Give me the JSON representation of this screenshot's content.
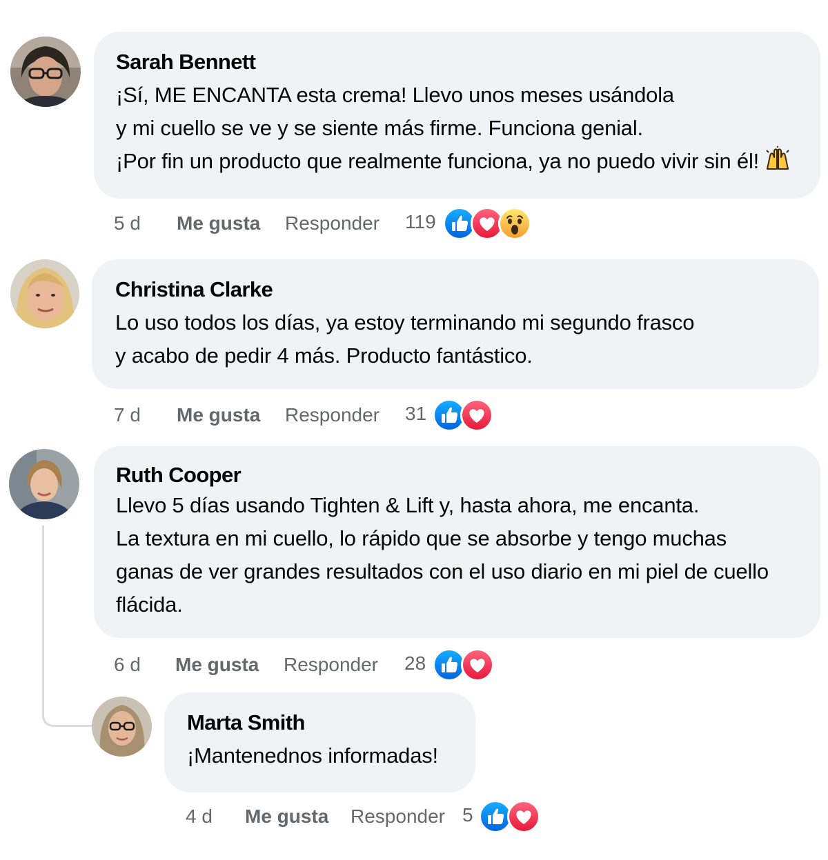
{
  "comments": [
    {
      "author": "Sarah Bennett",
      "lines": [
        "¡Sí, ME ENCANTA esta crema! Llevo unos meses usándola",
        "y mi cuello se ve y se siente más firme. Funciona genial.",
        "¡Por fin un producto que realmente funciona, ya no puedo vivir sin él!"
      ],
      "trailing_emoji": "🙌",
      "time": "5 d",
      "like_label": "Me gusta",
      "reply_label": "Responder",
      "reaction_count": "119",
      "reactions": [
        "like-icon",
        "love-icon",
        "wow-icon"
      ]
    },
    {
      "author": "Christina Clarke",
      "lines": [
        "Lo uso todos los días, ya estoy terminando mi segundo frasco",
        "y acabo de pedir 4 más. Producto fantástico."
      ],
      "time": "7 d",
      "like_label": "Me gusta",
      "reply_label": "Responder",
      "reaction_count": "31",
      "reactions": [
        "like-icon",
        "love-icon"
      ]
    },
    {
      "author": "Ruth Cooper",
      "lines": [
        "Llevo 5 días usando Tighten & Lift y, hasta ahora, me encanta.",
        "La textura en mi cuello, lo rápido que se absorbe y tengo muchas",
        "ganas de ver grandes resultados con el uso diario en mi piel de cuello",
        "flácida."
      ],
      "time": "6 d",
      "like_label": "Me gusta",
      "reply_label": "Responder",
      "reaction_count": "28",
      "reactions": [
        "like-icon",
        "love-icon"
      ]
    },
    {
      "author": "Marta Smith",
      "lines": [
        "¡Mantenednos informadas!"
      ],
      "time": "4 d",
      "like_label": "Me gusta",
      "reply_label": "Responder",
      "reaction_count": "5",
      "reactions": [
        "like-icon",
        "love-icon"
      ]
    }
  ],
  "colors": {
    "bubble": "#f0f2f5",
    "meta_text": "#65676b",
    "like_blue": "#1877f2",
    "love_red": "#f33e58",
    "wow_yellow": "#f7b125"
  }
}
